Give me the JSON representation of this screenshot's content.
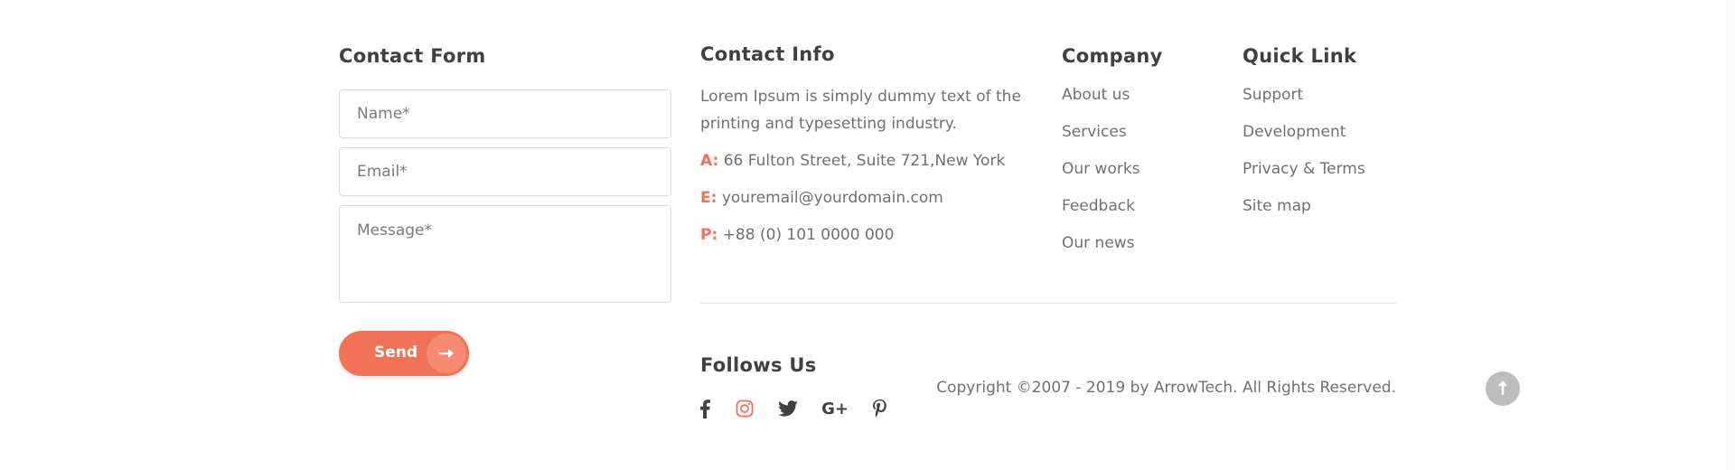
{
  "contact_form": {
    "title": "Contact Form",
    "name_placeholder": "Name*",
    "email_placeholder": "Email*",
    "message_placeholder": "Message*",
    "send_label": "Send"
  },
  "contact_info": {
    "title": "Contact Info",
    "description": "Lorem Ipsum is simply dummy text of the printing and typesetting industry.",
    "address_label": "A:",
    "address": "66 Fulton Street, Suite 721,New York",
    "email_label": "E:",
    "email": "youremail@yourdomain.com",
    "phone_label": "P:",
    "phone": "+88 (0) 101 0000 000"
  },
  "company": {
    "title": "Company",
    "links": [
      "About us",
      "Services",
      "Our works",
      "Feedback",
      "Our news"
    ]
  },
  "quick_link": {
    "title": "Quick Link",
    "links": [
      "Support",
      "Development",
      "Privacy & Terms",
      "Site map"
    ]
  },
  "follows": {
    "title": "Follows Us",
    "icons": [
      "facebook-icon",
      "instagram-icon",
      "twitter-icon",
      "google-plus-icon",
      "pinterest-icon"
    ],
    "google_plus_text": "G+"
  },
  "copyright": "Copyright ©2007 - 2019 by ArrowTech. All Rights Reserved.",
  "colors": {
    "accent": "#f07357",
    "heading": "#404040",
    "text": "#707070",
    "to_top_bg": "#bdbdbd"
  }
}
